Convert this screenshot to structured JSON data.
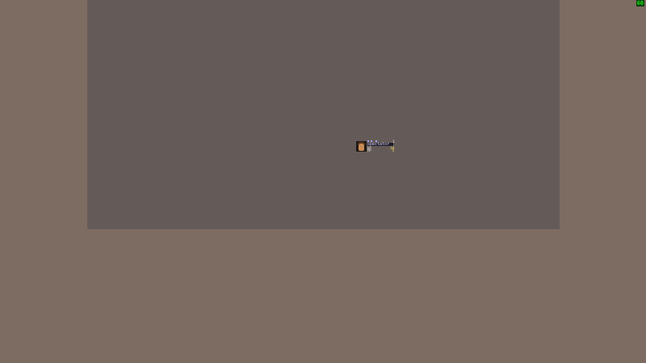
{
  "hud": {
    "fps": "60"
  },
  "player": {
    "name": "spectator",
    "level": "1",
    "stats": [
      {
        "label": "HP",
        "value": "10"
      },
      {
        "label": "MP",
        "value": "5"
      }
    ]
  },
  "colors": {
    "outer_background": "#7d6c62",
    "game_area": "#645b58",
    "fps_text": "#19e419"
  }
}
